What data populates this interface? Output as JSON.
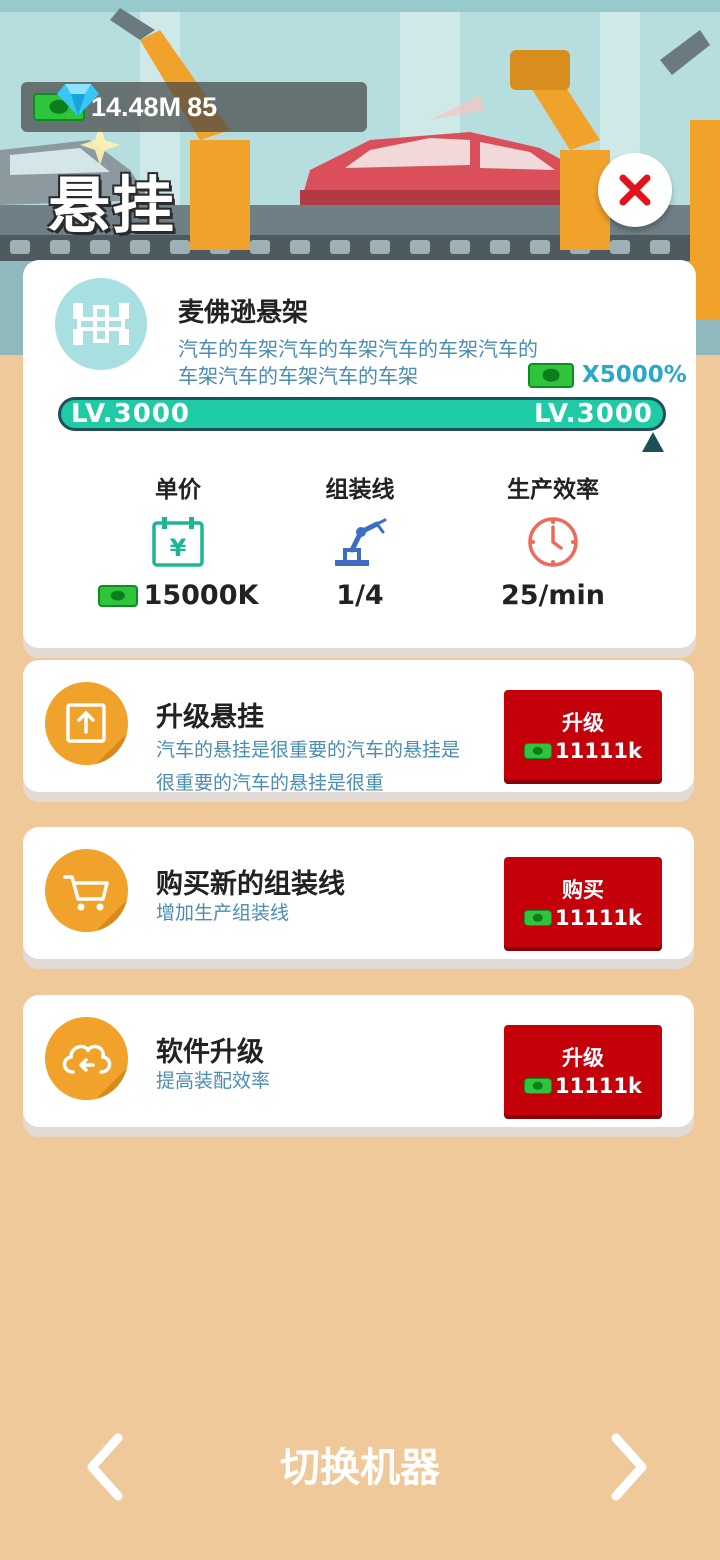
{
  "currency": {
    "money": "14.48M",
    "gems": "85"
  },
  "page_title": "悬挂",
  "part": {
    "name": "麦佛逊悬架",
    "description": "汽车的车架汽车的车架汽车的车架汽车的车架汽车的车架汽车的车架",
    "bonus": "X5000%",
    "level_current": "LV.3000",
    "level_max": "LV.3000",
    "level_progress": 1.0
  },
  "stats": [
    {
      "label": "单价",
      "value": "15000K",
      "icon": "price-tag-icon"
    },
    {
      "label": "组装线",
      "value": "1/4",
      "icon": "robot-arm-icon"
    },
    {
      "label": "生产效率",
      "value": "25/min",
      "icon": "clock-icon"
    }
  ],
  "actions": [
    {
      "title": "升级悬挂",
      "description": "汽车的悬挂是很重要的汽车的悬挂是很重要的汽车的悬挂是很重",
      "button": "升级",
      "cost": "11111k",
      "icon": "upgrade-icon"
    },
    {
      "title": "购买新的组装线",
      "description": "增加生产组装线",
      "button": "购买",
      "cost": "11111k",
      "icon": "cart-icon"
    },
    {
      "title": "软件升级",
      "description": "提高装配效率",
      "button": "升级",
      "cost": "11111k",
      "icon": "cloud-icon"
    }
  ],
  "footer": {
    "switch_label": "切换机器"
  },
  "colors": {
    "background": "#f0c99b",
    "accent_teal": "#1fcaa6",
    "button_red": "#c4000b",
    "icon_orange": "#f0a22a",
    "desc_blue": "#4a8db3"
  }
}
